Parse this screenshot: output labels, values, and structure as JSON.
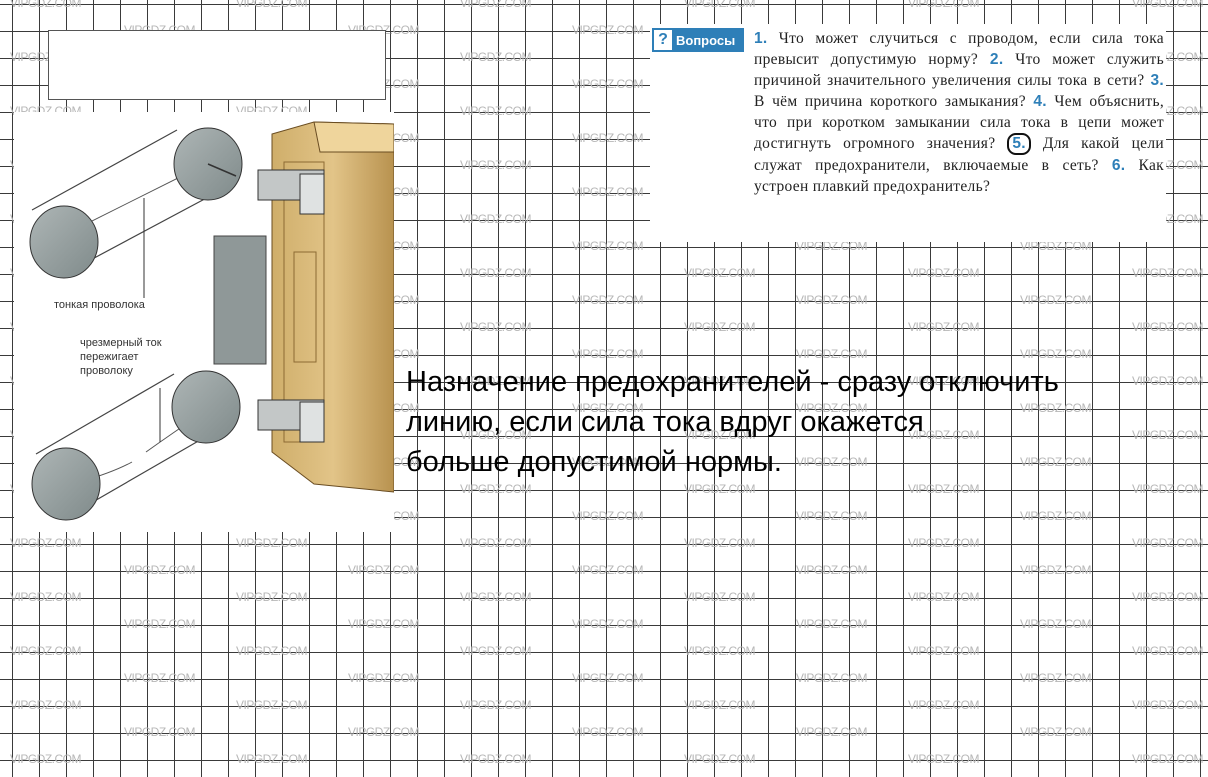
{
  "watermark": {
    "text": "VIPGDZ.COM"
  },
  "questions": {
    "header_label": "Вопросы",
    "header_icon": "question-mark-icon",
    "accent_color": "#2e7fb8",
    "items": [
      {
        "num": "1.",
        "text": "Что может случиться с проводом, если сила тока превысит допустимую норму?"
      },
      {
        "num": "2.",
        "text": "Что может служить причиной значительного увеличения силы тока в сети?"
      },
      {
        "num": "3.",
        "text": "В чём причина короткого замыкания?"
      },
      {
        "num": "4.",
        "text": "Чем объяснить, что при коротком замыкании сила тока в цепи может достигнуть огромного значения?"
      },
      {
        "num": "5.",
        "text": "Для какой цели служат предохранители, включаемые в сеть?"
      },
      {
        "num": "6.",
        "text": "Как устроен плавкий предохранитель?"
      }
    ]
  },
  "figure": {
    "label_thin_wire": "тонкая проволока",
    "label_overcurrent_lines": [
      "чрезмерный ток",
      "пережигает",
      "проволоку"
    ]
  },
  "answer": {
    "lines": [
      "Назначение предохранителей - сразу отключить",
      "линию, если сила тока вдруг окажется",
      "больше допустимой нормы."
    ]
  }
}
